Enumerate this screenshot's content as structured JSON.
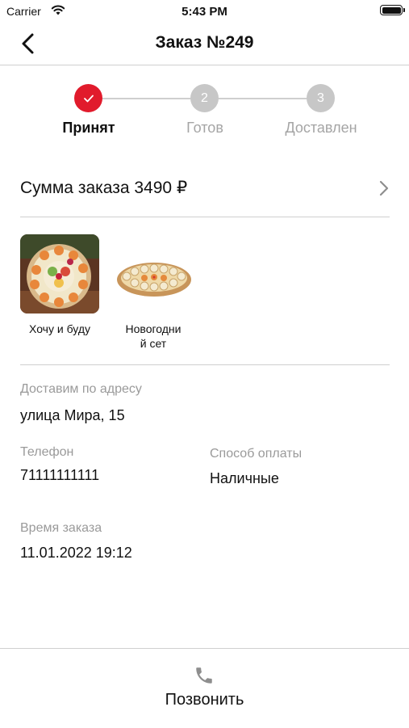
{
  "status_bar": {
    "carrier": "Carrier",
    "time": "5:43 PM"
  },
  "nav": {
    "title": "Заказ №249"
  },
  "stepper": {
    "steps": [
      {
        "label": "Принят",
        "number": "",
        "done": true
      },
      {
        "label": "Готов",
        "number": "2",
        "done": false
      },
      {
        "label": "Доставлен",
        "number": "3",
        "done": false
      }
    ]
  },
  "order_sum": {
    "text": "Сумма заказа 3490 ₽"
  },
  "items": [
    {
      "name": "Хочу и буду"
    },
    {
      "name": "Новогодний сет",
      "name_display": "Новогодни\nй сет"
    }
  ],
  "delivery": {
    "label": "Доставим по адресу",
    "value": "улица Мира, 15"
  },
  "phone": {
    "label": "Телефон",
    "value": "71111111111"
  },
  "payment": {
    "label": "Способ оплаты",
    "value": "Наличные"
  },
  "order_time": {
    "label": "Время заказа",
    "value": "11.01.2022 19:12"
  },
  "call_button": {
    "label": "Позвонить"
  },
  "colors": {
    "accent": "#e11b2c",
    "inactive": "#c7c7c7",
    "muted_text": "#9a9a9a",
    "divider": "#cfcfcf"
  }
}
